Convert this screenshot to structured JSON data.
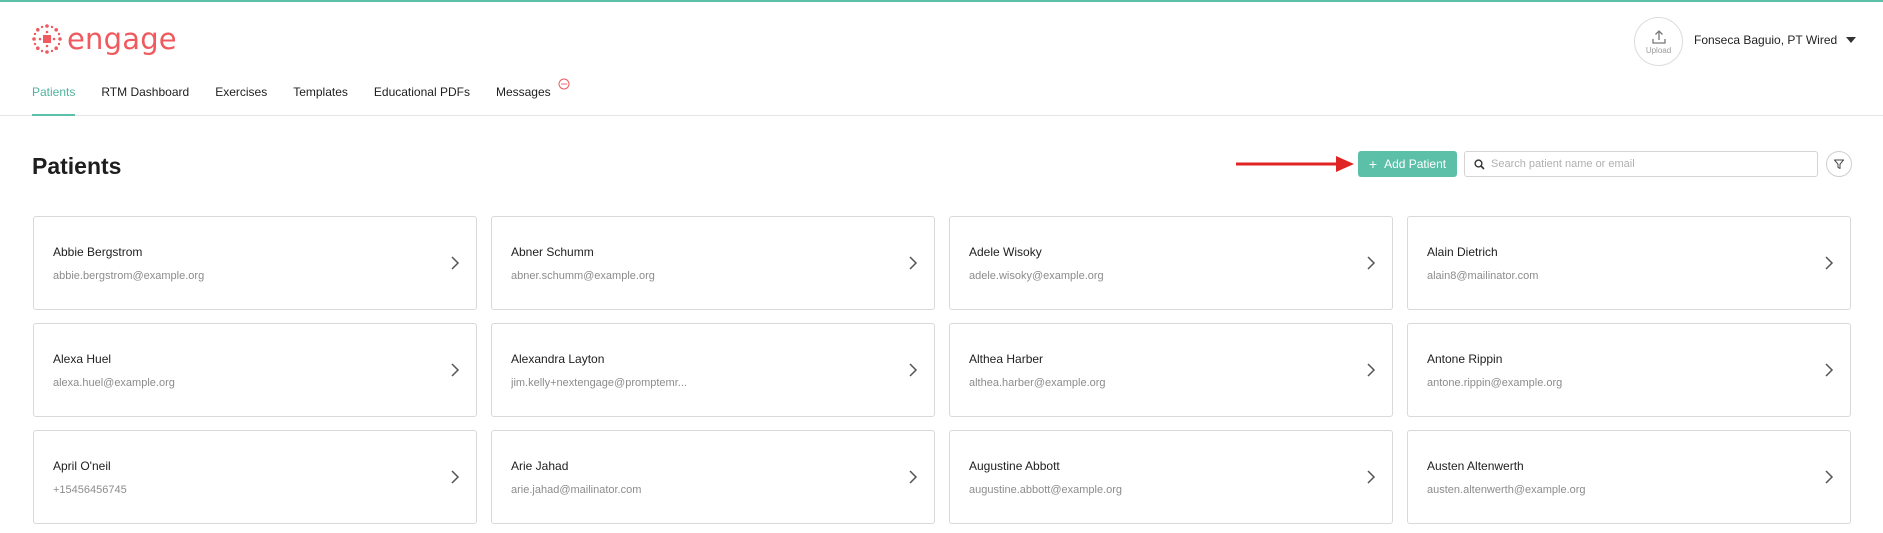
{
  "brand": {
    "name": "engage",
    "color": "#ef5a5f"
  },
  "header": {
    "upload_label": "Upload",
    "user_name": "Fonseca Baguio, PT Wired"
  },
  "nav": {
    "items": [
      {
        "label": "Patients",
        "active": true
      },
      {
        "label": "RTM Dashboard",
        "active": false
      },
      {
        "label": "Exercises",
        "active": false
      },
      {
        "label": "Templates",
        "active": false
      },
      {
        "label": "Educational PDFs",
        "active": false
      },
      {
        "label": "Messages",
        "active": false
      }
    ]
  },
  "page": {
    "title": "Patients",
    "add_button_label": "Add Patient",
    "search_placeholder": "Search patient name or email"
  },
  "colors": {
    "accent": "#5cbfa8",
    "arrow": "#e02424"
  },
  "patients": [
    {
      "name": "Abbie Bergstrom",
      "contact": "abbie.bergstrom@example.org"
    },
    {
      "name": "Abner Schumm",
      "contact": "abner.schumm@example.org"
    },
    {
      "name": "Adele Wisoky",
      "contact": "adele.wisoky@example.org"
    },
    {
      "name": "Alain Dietrich",
      "contact": "alain8@mailinator.com"
    },
    {
      "name": "Alexa Huel",
      "contact": "alexa.huel@example.org"
    },
    {
      "name": "Alexandra Layton",
      "contact": "jim.kelly+nextengage@promptemr..."
    },
    {
      "name": "Althea Harber",
      "contact": "althea.harber@example.org"
    },
    {
      "name": "Antone Rippin",
      "contact": "antone.rippin@example.org"
    },
    {
      "name": "April O'neil",
      "contact": "+15456456745"
    },
    {
      "name": "Arie Jahad",
      "contact": "arie.jahad@mailinator.com"
    },
    {
      "name": "Augustine Abbott",
      "contact": "augustine.abbott@example.org"
    },
    {
      "name": "Austen Altenwerth",
      "contact": "austen.altenwerth@example.org"
    }
  ]
}
